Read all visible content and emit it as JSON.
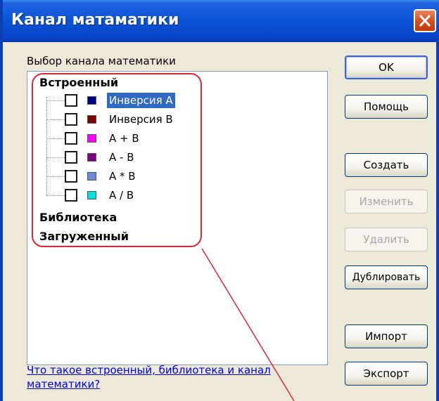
{
  "window": {
    "title": "Канал матаматики"
  },
  "panel": {
    "group_label": "Выбор канала математики",
    "categories": {
      "builtin": "Встроенный",
      "library": "Библиотека",
      "loaded": "Загруженный"
    },
    "items": [
      {
        "label": "Инверсия А",
        "color": "#000080",
        "checked": false,
        "selected": true
      },
      {
        "label": "Инверсия В",
        "color": "#800000",
        "checked": false,
        "selected": false
      },
      {
        "label": "А + В",
        "color": "#ff00ff",
        "checked": false,
        "selected": false
      },
      {
        "label": "А - В",
        "color": "#800080",
        "checked": false,
        "selected": false
      },
      {
        "label": "А * В",
        "color": "#6a8fd8",
        "checked": false,
        "selected": false
      },
      {
        "label": "А / В",
        "color": "#00e0e0",
        "checked": false,
        "selected": false
      }
    ],
    "help_link": "Что такое встроенный, библиотека и канал математики?"
  },
  "buttons": {
    "ok": "OK",
    "help": "Помощь",
    "create": "Создать",
    "edit": "Изменить",
    "delete": "Удалить",
    "duplicate": "Дублировать",
    "import": "Импорт",
    "export": "Экспорт"
  },
  "colors": {
    "titlebar": "#0a52d8",
    "selection": "#316ac5",
    "annotation": "#e0253a",
    "dialog_bg": "#ece9d8"
  }
}
